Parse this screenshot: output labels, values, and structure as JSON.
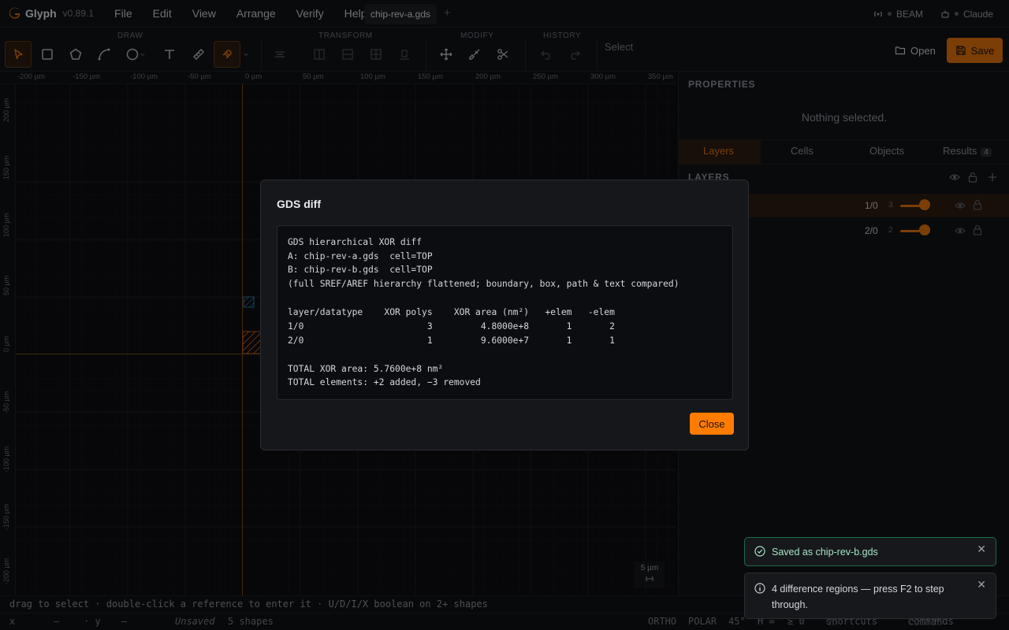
{
  "app": {
    "name": "Glyph",
    "version": "v0.89.1"
  },
  "menu": [
    "File",
    "Edit",
    "View",
    "Arrange",
    "Verify",
    "Help"
  ],
  "doc_tab": "chip-rev-a.gds",
  "status_right": {
    "beam": "BEAM",
    "claude": "Claude"
  },
  "toolbar": {
    "groups": {
      "draw": "DRAW",
      "transform": "TRANSFORM",
      "modify": "MODIFY",
      "history": "HISTORY"
    },
    "select_label": "Select",
    "open_label": "Open",
    "save_label": "Save"
  },
  "rulers": {
    "top": [
      "-200 µm",
      "-150 µm",
      "-100 µm",
      "-50 µm",
      "0 µm",
      "50 µm",
      "100 µm",
      "150 µm",
      "200 µm",
      "250 µm",
      "300 µm",
      "350 µm"
    ],
    "left": [
      "200 µm",
      "150 µm",
      "100 µm",
      "50 µm",
      "0 µm",
      "-50 µm",
      "-100 µm",
      "-150 µm",
      "-200 µm"
    ]
  },
  "scale": {
    "label": "5 µm"
  },
  "panel": {
    "properties_title": "PROPERTIES",
    "nothing_selected": "Nothing selected.",
    "tabs": [
      "Layers",
      "Cells",
      "Objects",
      "Results"
    ],
    "results_badge": "4",
    "layers_title": "LAYERS",
    "layers": [
      {
        "name": "1/0",
        "count": "3"
      },
      {
        "name": "2/0",
        "count": "2"
      }
    ]
  },
  "modal": {
    "title": "GDS diff",
    "lines": [
      "GDS hierarchical XOR diff",
      "A: chip-rev-a.gds  cell=TOP",
      "B: chip-rev-b.gds  cell=TOP",
      "(full SREF/AREF hierarchy flattened; boundary, box, path & text compared)",
      "",
      "layer/datatype    XOR polys    XOR area (nm²)   +elem   -elem",
      "1/0                       3         4.8000e+8       1       2",
      "2/0                       1         9.6000e+7       1       1",
      "",
      "TOTAL XOR area: 5.7600e+8 nm²",
      "TOTAL elements: +2 added, −3 removed"
    ],
    "close_label": "Close"
  },
  "toasts": [
    {
      "text": "Saved as chip-rev-b.gds",
      "kind": "success"
    },
    {
      "text": "4 difference regions — press F2 to step through.",
      "kind": "info"
    }
  ],
  "hint": "drag to select · double-click a reference to enter it · U/D/I/X boolean on 2+ shapes",
  "statusbar": {
    "x_label": "x",
    "x_val": "—",
    "y_label": "· y",
    "y_val": "—",
    "unsaved": "Unsaved",
    "shapes": "5 shapes",
    "ortho": "ORTHO",
    "polar": "POLAR",
    "angle": "45°",
    "h": "H ∞",
    "ge": "≥ 0",
    "shortcuts_key": "?",
    "shortcuts": "shortcuts",
    "commands_key": "Ctrl+K",
    "commands": "commands"
  },
  "colors": {
    "accent": "#e0720c",
    "success": "#1e6a4a"
  }
}
